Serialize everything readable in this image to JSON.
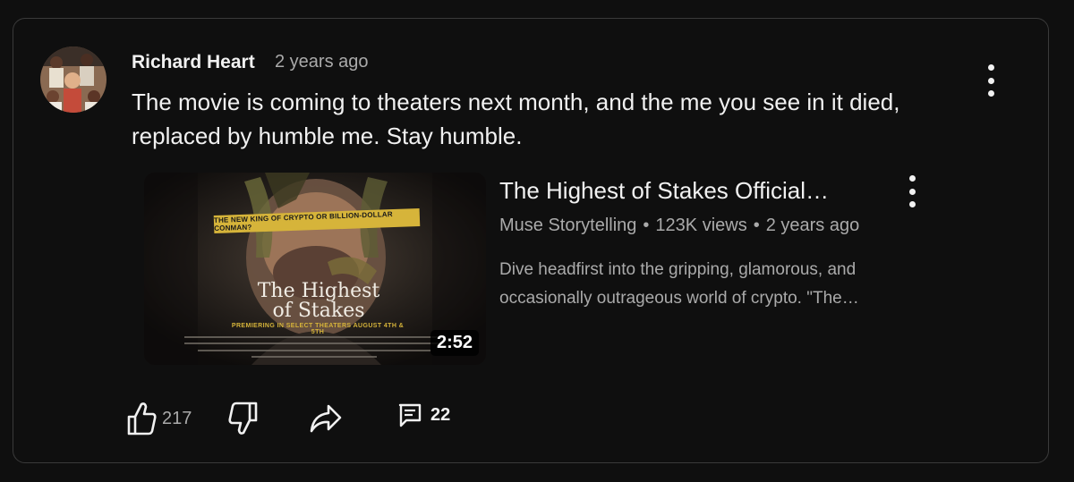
{
  "comment": {
    "author": "Richard Heart",
    "time": "2 years ago",
    "text": "The movie is coming to theaters next month, and the me you see in it died, replaced by humble me. Stay humble.",
    "menu_icon": "more-vert-icon"
  },
  "video": {
    "title": "The Highest of Stakes Official…",
    "channel": "Muse Storytelling",
    "views": "123K views",
    "age": "2 years ago",
    "description": "Dive headfirst into the gripping, glamorous, and occasionally outrageous world of crypto. \"The…",
    "duration": "2:52",
    "thumbnail": {
      "tagline": "THE NEW KING OF CRYPTO OR BILLION-DOLLAR CONMAN?",
      "title_line1": "The Highest",
      "title_line2": "of Stakes",
      "premiere": "PREMIERING IN SELECT THEATERS  AUGUST 4TH & 5TH"
    }
  },
  "actions": {
    "like_icon": "thumbs-up-icon",
    "like_count": "217",
    "dislike_icon": "thumbs-down-icon",
    "share_icon": "share-arrow-icon",
    "reply_icon": "comment-icon",
    "reply_count": "22"
  },
  "colors": {
    "background": "#0f0f0f",
    "border": "#3a3a3a",
    "primary_text": "#f1f1f1",
    "secondary_text": "#aaaaaa",
    "poster_gold": "#d6b43a"
  }
}
